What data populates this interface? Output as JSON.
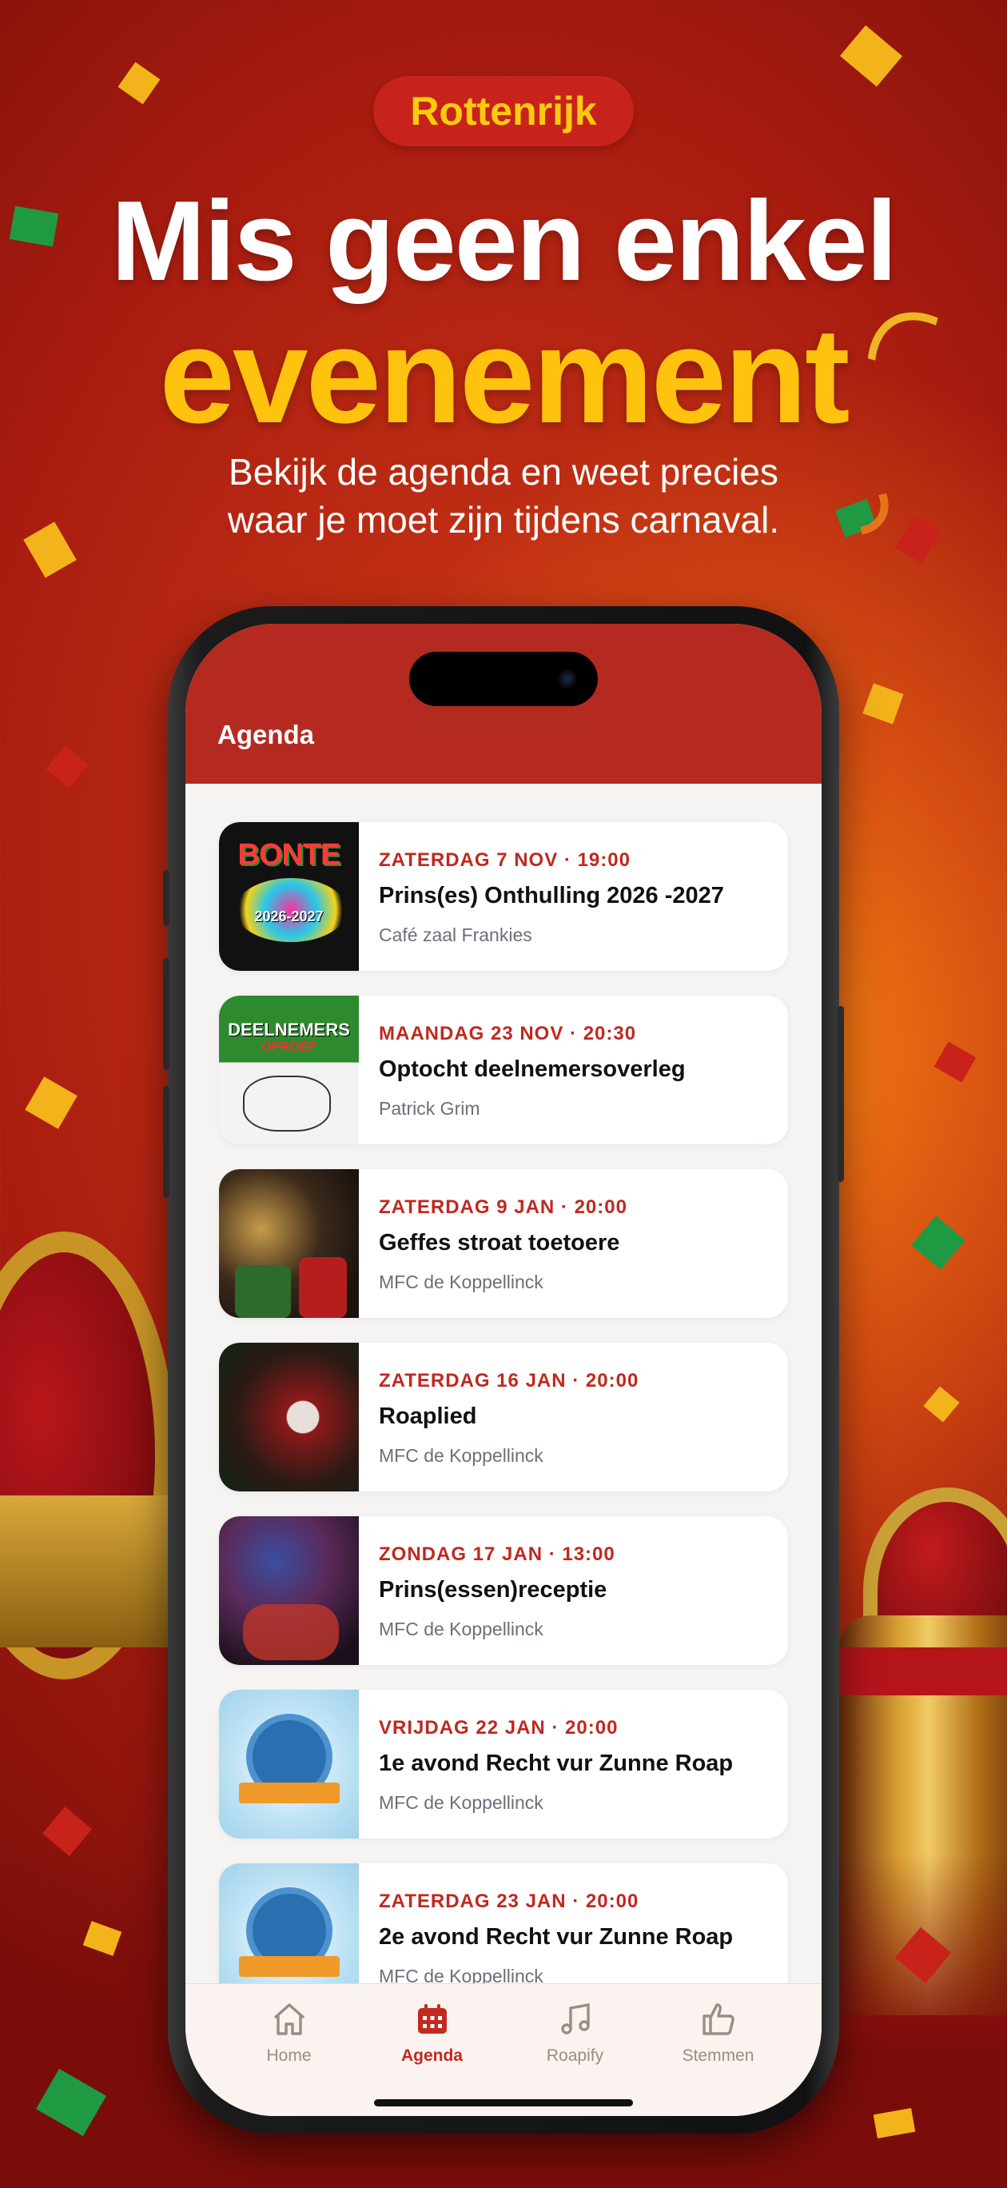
{
  "brand": "Rottenrijk",
  "headline": {
    "line1": "Mis geen enkel",
    "line2": "evenement"
  },
  "subtitle": {
    "line1": "Bekijk de agenda en weet precies",
    "line2": "waar je moet zijn tijdens carnaval."
  },
  "app": {
    "header_title": "Agenda",
    "events": [
      {
        "date": "ZATERDAG 7 NOV · 19:00",
        "title": "Prins(es) Onthulling 2026 -2027",
        "location": "Café zaal Frankies",
        "thumb_text": "BONTE",
        "thumb_text2": "2026-2027"
      },
      {
        "date": "MAANDAG 23 NOV · 20:30",
        "title": "Optocht deelnemersoverleg",
        "location": "Patrick Grim",
        "thumb_text": "DEELNEMERS",
        "thumb_text2": "OPROEP"
      },
      {
        "date": "ZATERDAG 9 JAN · 20:00",
        "title": "Geffes stroat toetoere",
        "location": "MFC de Koppellinck"
      },
      {
        "date": "ZATERDAG 16 JAN · 20:00",
        "title": "Roaplied",
        "location": "MFC de Koppellinck"
      },
      {
        "date": "ZONDAG 17 JAN · 13:00",
        "title": "Prins(essen)receptie",
        "location": "MFC de Koppellinck"
      },
      {
        "date": "VRIJDAG 22 JAN · 20:00",
        "title": "1e avond Recht vur Zunne Roap",
        "location": "MFC de Koppellinck"
      },
      {
        "date": "ZATERDAG 23 JAN · 20:00",
        "title": "2e avond Recht vur Zunne Roap",
        "location": "MFC de Koppellinck"
      }
    ],
    "tabs": [
      {
        "label": "Home",
        "icon": "home-icon"
      },
      {
        "label": "Agenda",
        "icon": "calendar-icon",
        "active": true
      },
      {
        "label": "Roapify",
        "icon": "music-icon"
      },
      {
        "label": "Stemmen",
        "icon": "thumbs-up-icon"
      }
    ]
  },
  "colors": {
    "accent": "#c12a20",
    "header": "#b52a20",
    "gold": "#ffc20e"
  }
}
